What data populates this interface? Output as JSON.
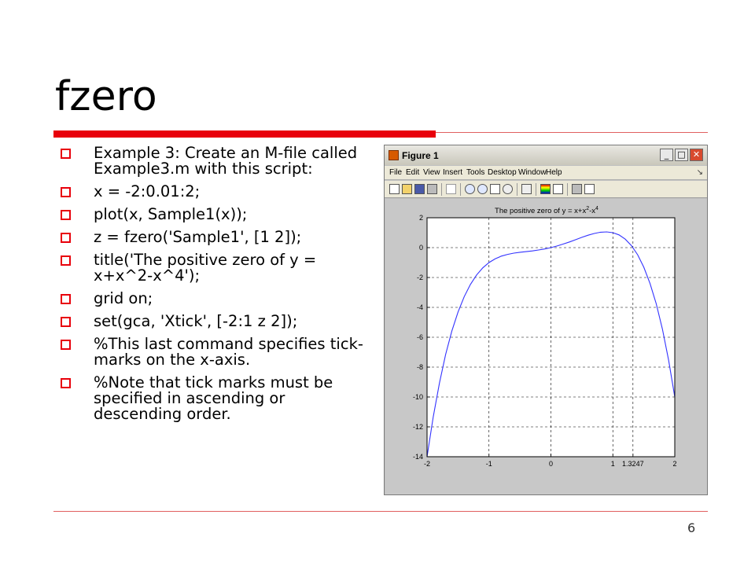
{
  "slide": {
    "title": "fzero",
    "page_number": "6",
    "bullets": [
      "Example 3:  Create an M-file called Example3.m with this script:",
      "x = -2:0.01:2;",
      "plot(x, Sample1(x));",
      "z = fzero('Sample1', [1 2]);",
      "title('The positive zero of y = x+x^2-x^4');",
      "grid on;",
      "set(gca, 'Xtick', [-2:1 z 2]);",
      "%This last command specifies tick-marks on the x-axis.",
      "%Note that tick marks must be specified in ascending or descending order."
    ]
  },
  "figure_window": {
    "title": "Figure 1",
    "window_buttons": [
      "_",
      "□",
      "✕"
    ],
    "menu": [
      "File",
      "Edit",
      "View",
      "Insert",
      "Tools",
      "Desktop",
      "Window",
      "Help"
    ],
    "menu_arrow": "↘",
    "toolbar_icons": [
      "new-icon",
      "open-icon",
      "save-icon",
      "print-icon",
      "pointer-icon",
      "zoom-in-icon",
      "zoom-out-icon",
      "pan-icon",
      "rotate-icon",
      "data-cursor-icon",
      "colorbar-icon",
      "legend-icon",
      "hide-tools-icon",
      "show-tools-icon"
    ],
    "colors": {
      "plot_line": "#3333ff",
      "axes_bg": "#ffffff",
      "figure_bg": "#c8c8c8",
      "slide_accent": "#e8000b"
    }
  },
  "chart_data": {
    "type": "line",
    "title_base": "The positive zero of y = x+x",
    "title_exp1": "2",
    "title_mid": "-x",
    "title_exp2": "4",
    "xlim": [
      -2,
      2
    ],
    "ylim": [
      -14,
      2
    ],
    "xticks": [
      -2,
      -1,
      0,
      1,
      1.3247,
      2
    ],
    "xtick_labels": [
      "-2",
      "-1",
      "0",
      "1",
      "1.3247",
      "2"
    ],
    "yticks": [
      2,
      0,
      -2,
      -4,
      -6,
      -8,
      -10,
      -12,
      -14
    ],
    "ytick_labels": [
      "2",
      "0",
      "-2",
      "-4",
      "-6",
      "-8",
      "-10",
      "-12",
      "-14"
    ],
    "grid": true,
    "series": [
      {
        "x": [
          -2,
          -1.9,
          -1.8,
          -1.7,
          -1.6,
          -1.5,
          -1.4,
          -1.3,
          -1.2,
          -1.1,
          -1,
          -0.9,
          -0.8,
          -0.7,
          -0.6,
          -0.5,
          -0.4,
          -0.3,
          -0.2,
          -0.1,
          0,
          0.1,
          0.2,
          0.3,
          0.4,
          0.5,
          0.6,
          0.7,
          0.8,
          0.9,
          1,
          1.1,
          1.2,
          1.3,
          1.4,
          1.5,
          1.6,
          1.7,
          1.8,
          1.9,
          2
        ],
        "y": [
          -14,
          -11.32,
          -9.06,
          -7.16,
          -5.59,
          -4.31,
          -3.28,
          -2.47,
          -1.83,
          -1.35,
          -1,
          -0.75,
          -0.57,
          -0.45,
          -0.37,
          -0.31,
          -0.27,
          -0.22,
          -0.16,
          -0.09,
          0,
          0.11,
          0.24,
          0.38,
          0.53,
          0.69,
          0.83,
          0.95,
          1.03,
          1.05,
          1,
          0.85,
          0.57,
          0.13,
          -0.48,
          -1.31,
          -2.4,
          -3.76,
          -5.46,
          -7.52,
          -10
        ]
      }
    ]
  }
}
